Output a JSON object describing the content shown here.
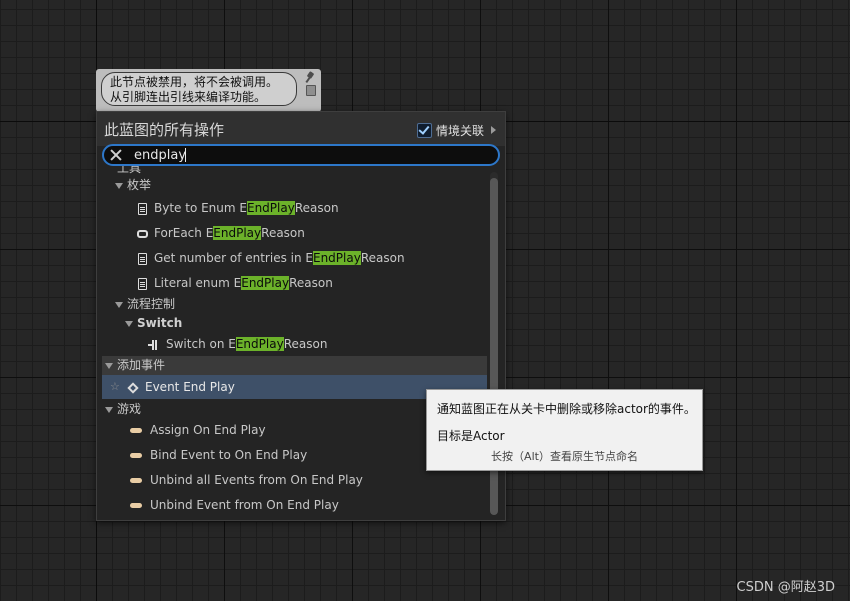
{
  "node_comment": {
    "line1": "此节点被禁用，将不会被调用。",
    "line2": "从引脚连出引线来编译功能。"
  },
  "menu": {
    "title": "此蓝图的所有操作",
    "context_sensitive_label": "情境关联",
    "context_sensitive_checked": true,
    "search_value": "endplay",
    "rows": {
      "partial_category": "工具",
      "enum_category": "枚举",
      "byte_to_enum": {
        "pre": "Byte to Enum E",
        "hl": "EndPlay",
        "post": "Reason"
      },
      "foreach": {
        "pre": "ForEach E",
        "hl": "EndPlay",
        "post": "Reason"
      },
      "get_number": {
        "pre": "Get number of entries in E",
        "hl": "EndPlay",
        "post": "Reason"
      },
      "literal_enum": {
        "pre": "Literal enum E",
        "hl": "EndPlay",
        "post": "Reason"
      },
      "flow_category": "流程控制",
      "switch_category": "Switch",
      "switch_on": {
        "pre": "Switch on E",
        "hl": "EndPlay",
        "post": "Reason"
      },
      "add_event_category": "添加事件",
      "event_end_play": "Event End Play",
      "game_category": "游戏",
      "assign": "Assign On End Play",
      "bind": "Bind Event to On End Play",
      "unbind_all": "Unbind all Events from On End Play",
      "unbind": "Unbind Event from On End Play"
    }
  },
  "tooltip": {
    "description": "通知蓝图正在从关卡中删除或移除actor的事件。",
    "target": "目标是Actor",
    "hint": "长按（Alt）查看原生节点命名"
  },
  "watermark": "CSDN @阿赵3D",
  "colors": {
    "highlight": "#6cb22a",
    "search_border": "#2d77c9",
    "selected_row": "#3e5068"
  },
  "icons": {
    "enum": "document-icon",
    "foreach": "loop-icon",
    "switch": "switch-icon",
    "event": "event-diamond-icon",
    "delegate": "delegate-pill-icon"
  }
}
